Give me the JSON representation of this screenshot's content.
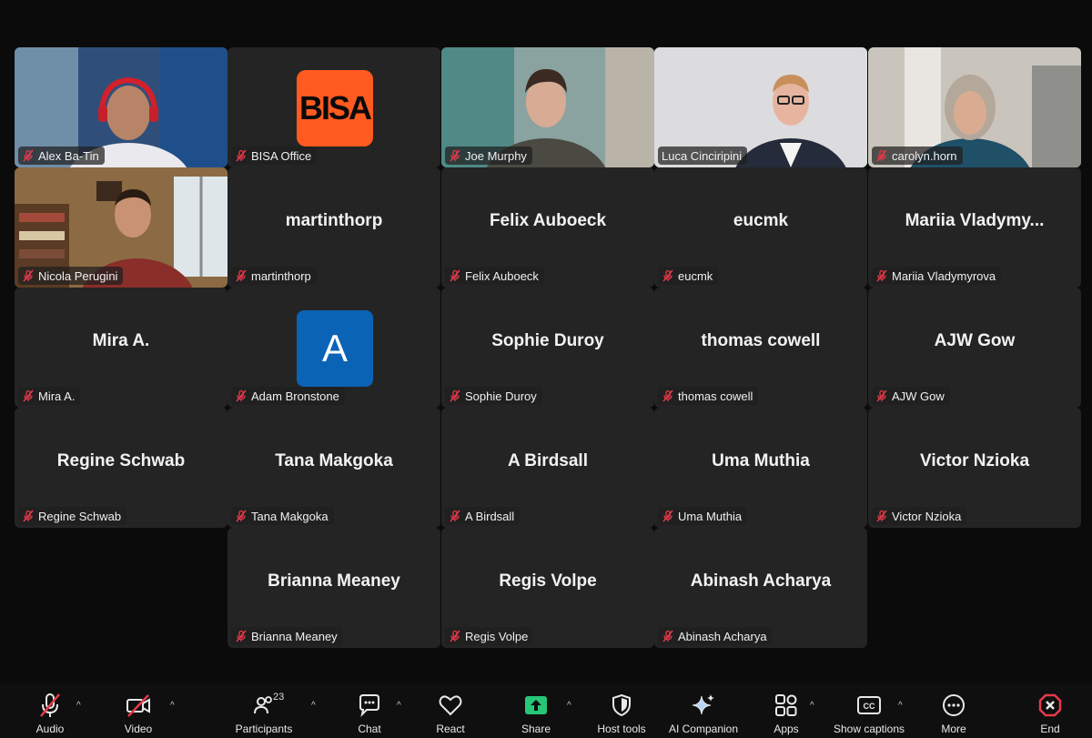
{
  "colors": {
    "active_border": "#22d27f",
    "tile_bg": "#242424",
    "bisa_orange": "#ff5a1f",
    "avatar_blue": "#0b63b6",
    "mute_red": "#e83a4a",
    "share_green": "#27c777"
  },
  "participants": {
    "alex": {
      "label": "Alex Ba-Tin"
    },
    "bisa": {
      "label": "BISA Office",
      "logo": "BISA"
    },
    "joe": {
      "label": "Joe Murphy"
    },
    "luca": {
      "label": "Luca Cinciripini"
    },
    "carolyn": {
      "label": "carolyn.horn"
    },
    "nicola": {
      "label": "Nicola Perugini"
    },
    "martinthorp": {
      "name": "martinthorp",
      "label": "martinthorp"
    },
    "felix": {
      "name": "Felix Auboeck",
      "label": "Felix Auboeck"
    },
    "eucmk": {
      "name": "eucmk",
      "label": "eucmk"
    },
    "mariia": {
      "name": "Mariia  Vladymy...",
      "label": "Mariia Vladymyrova"
    },
    "mira": {
      "name": "Mira A.",
      "label": "Mira A."
    },
    "adam": {
      "label": "Adam Bronstone",
      "initial": "A"
    },
    "sophie": {
      "name": "Sophie Duroy",
      "label": "Sophie Duroy"
    },
    "thomas": {
      "name": "thomas cowell",
      "label": "thomas cowell"
    },
    "ajw": {
      "name": "AJW Gow",
      "label": "AJW Gow"
    },
    "regine": {
      "name": "Regine Schwab",
      "label": "Regine Schwab"
    },
    "tana": {
      "name": "Tana Makgoka",
      "label": "Tana Makgoka"
    },
    "birdsall": {
      "name": "A Birdsall",
      "label": "A Birdsall"
    },
    "uma": {
      "name": "Uma Muthia",
      "label": "Uma Muthia"
    },
    "victor": {
      "name": "Victor Nzioka",
      "label": "Victor Nzioka"
    },
    "brianna": {
      "name": "Brianna Meaney",
      "label": "Brianna Meaney"
    },
    "regis": {
      "name": "Regis Volpe",
      "label": "Regis Volpe"
    },
    "abinash": {
      "name": "Abinash Acharya",
      "label": "Abinash Acharya"
    }
  },
  "toolbar": {
    "audio": "Audio",
    "video": "Video",
    "participants": "Participants",
    "participant_count": "23",
    "chat": "Chat",
    "react": "React",
    "share": "Share",
    "host_tools": "Host tools",
    "ai_companion": "AI Companion",
    "apps": "Apps",
    "show_captions": "Show captions",
    "cc": "CC",
    "more": "More",
    "end": "End"
  }
}
